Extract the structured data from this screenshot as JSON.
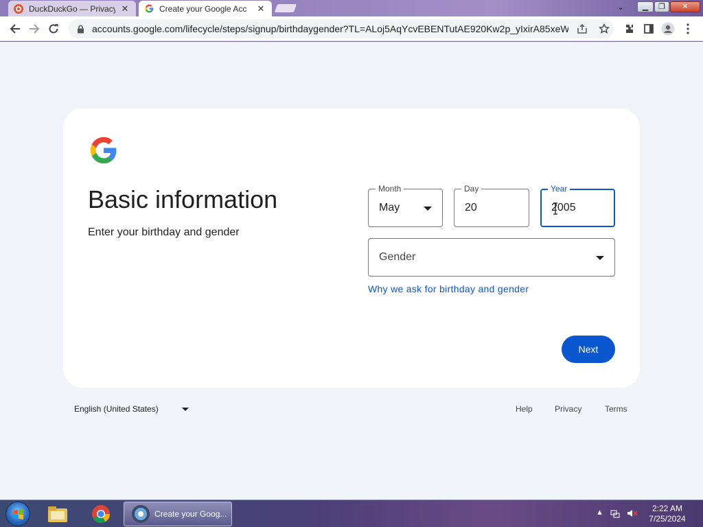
{
  "browser": {
    "tabs": [
      {
        "title": "DuckDuckGo — Privacy",
        "icon": "duckduckgo-icon"
      },
      {
        "title": "Create your Google Acc",
        "icon": "google-icon"
      }
    ],
    "url": "accounts.google.com/lifecycle/steps/signup/birthdaygender?TL=ALoj5AqYcvEBENTutAE920Kw2p_yIxirA85xeW..."
  },
  "form": {
    "heading": "Basic information",
    "subheading": "Enter your birthday and gender",
    "month": {
      "label": "Month",
      "value": "May"
    },
    "day": {
      "label": "Day",
      "value": "20"
    },
    "year": {
      "label": "Year",
      "value": "2005"
    },
    "gender": {
      "placeholder": "Gender"
    },
    "why_link": "Why we ask for birthday and gender",
    "next_label": "Next"
  },
  "footer": {
    "language": "English (United States)",
    "links": [
      "Help",
      "Privacy",
      "Terms"
    ]
  },
  "taskbar": {
    "active_window": "Create your Goog...",
    "time": "2:22 AM",
    "date": "7/25/2024"
  },
  "colors": {
    "accent": "#0b57d0",
    "page_bg": "#f0f4f9"
  }
}
